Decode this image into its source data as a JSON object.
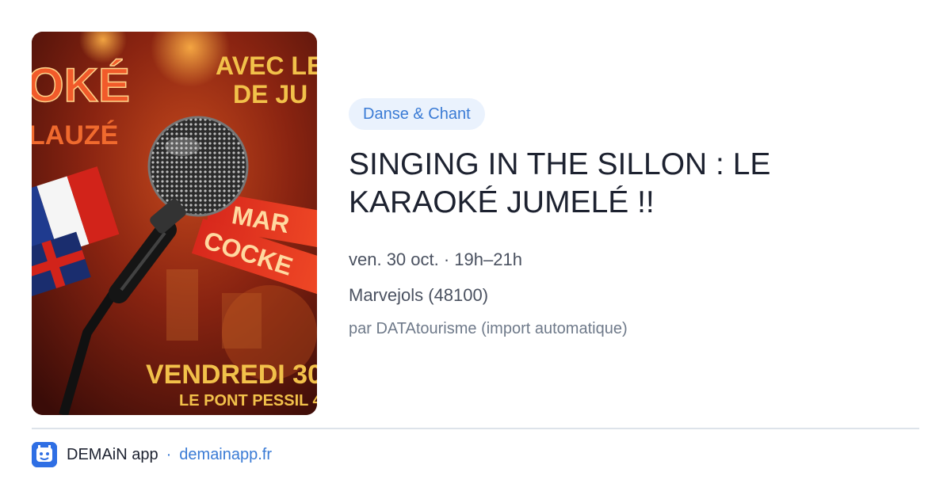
{
  "event": {
    "image": {
      "poster_text_top": "OKÉ",
      "poster_text_top_right": "AVEC LE",
      "poster_text_top_right_2": "DE JU",
      "poster_text_left": "LAUZÉ",
      "poster_text_banner_1": "MAR",
      "poster_text_banner_2": "COCKE",
      "poster_text_bottom": "VENDREDI 30",
      "poster_text_bottom_2": "LE PONT PESSIL 4"
    },
    "category": "Danse & Chant",
    "title": "SINGING IN THE SILLON : LE KARAOKÉ JUMELÉ !!",
    "date": "ven. 30 oct. · 19h–21h",
    "location": "Marvejols (48100)",
    "source": "par DATAtourisme (import automatique)"
  },
  "footer": {
    "app_name": "DEMAiN app",
    "separator": "·",
    "site": "demainapp.fr",
    "logo_icon": "app-logo-icon",
    "brand_color": "#2f6fe4",
    "link_color": "#3a7bd5"
  }
}
